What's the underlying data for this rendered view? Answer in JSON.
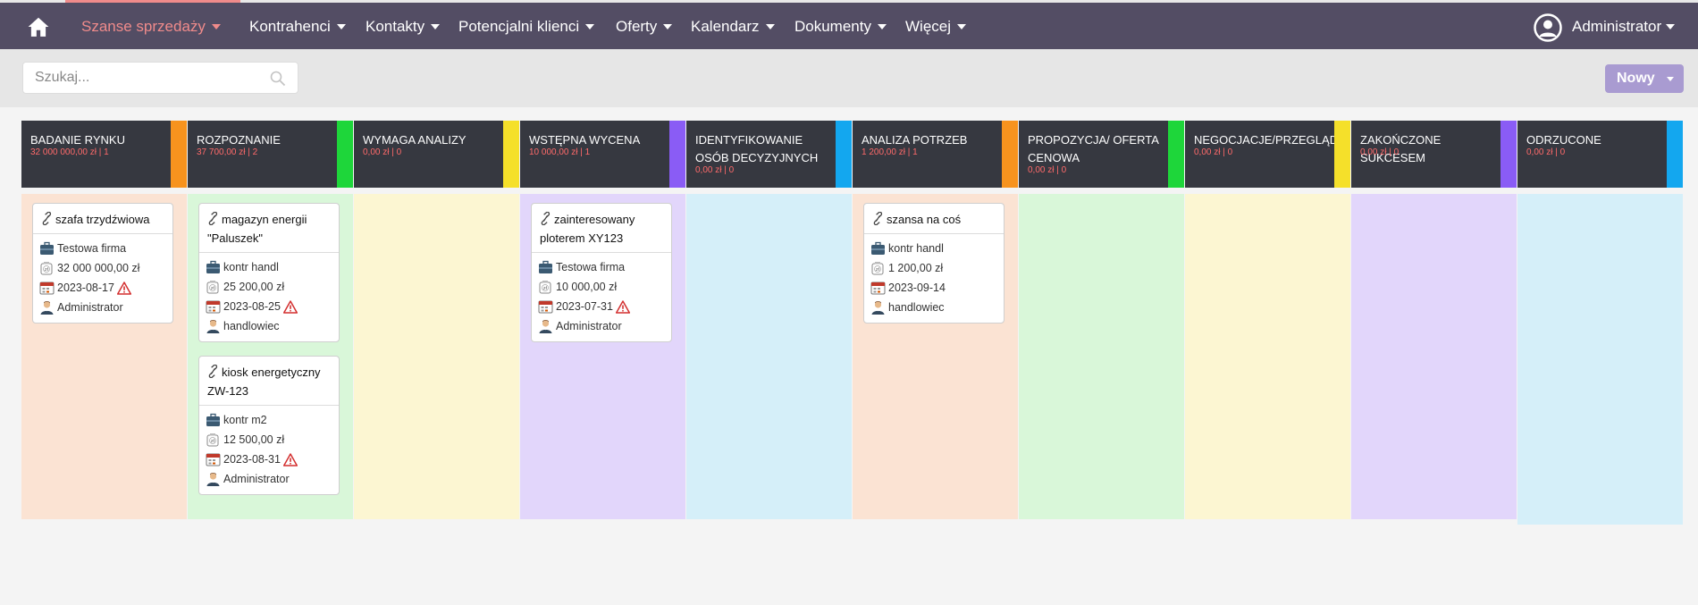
{
  "nav": {
    "items": [
      {
        "label": "Szanse sprzedaży"
      },
      {
        "label": "Kontrahenci"
      },
      {
        "label": "Kontakty"
      },
      {
        "label": "Potencjalni klienci"
      },
      {
        "label": "Oferty"
      },
      {
        "label": "Kalendarz"
      },
      {
        "label": "Dokumenty"
      },
      {
        "label": "Więcej"
      }
    ],
    "user": "Administrator",
    "active_color": "#f08b8b",
    "bar_color": "#534d64"
  },
  "toolbar": {
    "search_placeholder": "Szukaj...",
    "new_label": "Nowy",
    "new_color": "#a99bd1"
  },
  "columns": [
    {
      "title": "BADANIE RYNKU",
      "summary": "32 000 000,00 zł | 1",
      "stripe": "#f7931e",
      "bg": "#fbe3d3",
      "cards": [
        {
          "title": "szafa trzydźwiowa",
          "company": "Testowa firma",
          "amount": "32 000 000,00 zł",
          "date": "2023-08-17",
          "overdue": true,
          "owner": "Administrator"
        }
      ]
    },
    {
      "title": "ROZPOZNANIE",
      "summary": "37 700,00 zł | 2",
      "stripe": "#1ed63a",
      "bg": "#d9f7d9",
      "cards": [
        {
          "title": "magazyn energii \"Paluszek\"",
          "company": "kontr handl",
          "amount": "25 200,00 zł",
          "date": "2023-08-25",
          "overdue": true,
          "owner": "handlowiec"
        },
        {
          "title": "kiosk energetyczny ZW-123",
          "company": "kontr m2",
          "amount": "12 500,00 zł",
          "date": "2023-08-31",
          "overdue": true,
          "owner": "Administrator"
        }
      ]
    },
    {
      "title": "WYMAGA ANALIZY",
      "summary": "0,00 zł | 0",
      "stripe": "#f5e02a",
      "bg": "#fcf6d2",
      "cards": []
    },
    {
      "title": "WSTĘPNA WYCENA",
      "summary": "10 000,00 zł | 1",
      "stripe": "#8a5cf5",
      "bg": "#e2d6fb",
      "cards": [
        {
          "title": "zainteresowany ploterem XY123",
          "company": "Testowa firma",
          "amount": "10 000,00 zł",
          "date": "2023-07-31",
          "overdue": true,
          "owner": "Administrator"
        }
      ]
    },
    {
      "title": "IDENTYFIKOWANIE OSÓB DECYZYJNYCH",
      "summary": "0,00 zł | 0",
      "stripe": "#13a7ef",
      "bg": "#d5eff9",
      "cards": []
    },
    {
      "title": "ANALIZA POTRZEB",
      "summary": "1 200,00 zł | 1",
      "stripe": "#f7931e",
      "bg": "#fbe3d3",
      "cards": [
        {
          "title": "szansa na coś",
          "company": "kontr handl",
          "amount": "1 200,00 zł",
          "date": "2023-09-14",
          "overdue": false,
          "owner": "handlowiec"
        }
      ]
    },
    {
      "title": "PROPOZYCJA/ OFERTA CENOWA",
      "summary": "0,00 zł | 0",
      "stripe": "#1ed63a",
      "bg": "#d9f7d9",
      "cards": []
    },
    {
      "title": "NEGOCJACJE/PRZEGLĄD",
      "summary": "0,00 zł | 0",
      "stripe": "#f5e02a",
      "bg": "#fcf6d2",
      "cards": []
    },
    {
      "title": "ZAKOŃCZONE SUKCESEM",
      "summary": "0,00 zł | 0",
      "stripe": "#8a5cf5",
      "bg": "#e2d6fb",
      "cards": []
    },
    {
      "title": "ODRZUCONE",
      "summary": "0,00 zł | 0",
      "stripe": "#13a7ef",
      "bg": "#d5eff9",
      "cards": []
    }
  ]
}
